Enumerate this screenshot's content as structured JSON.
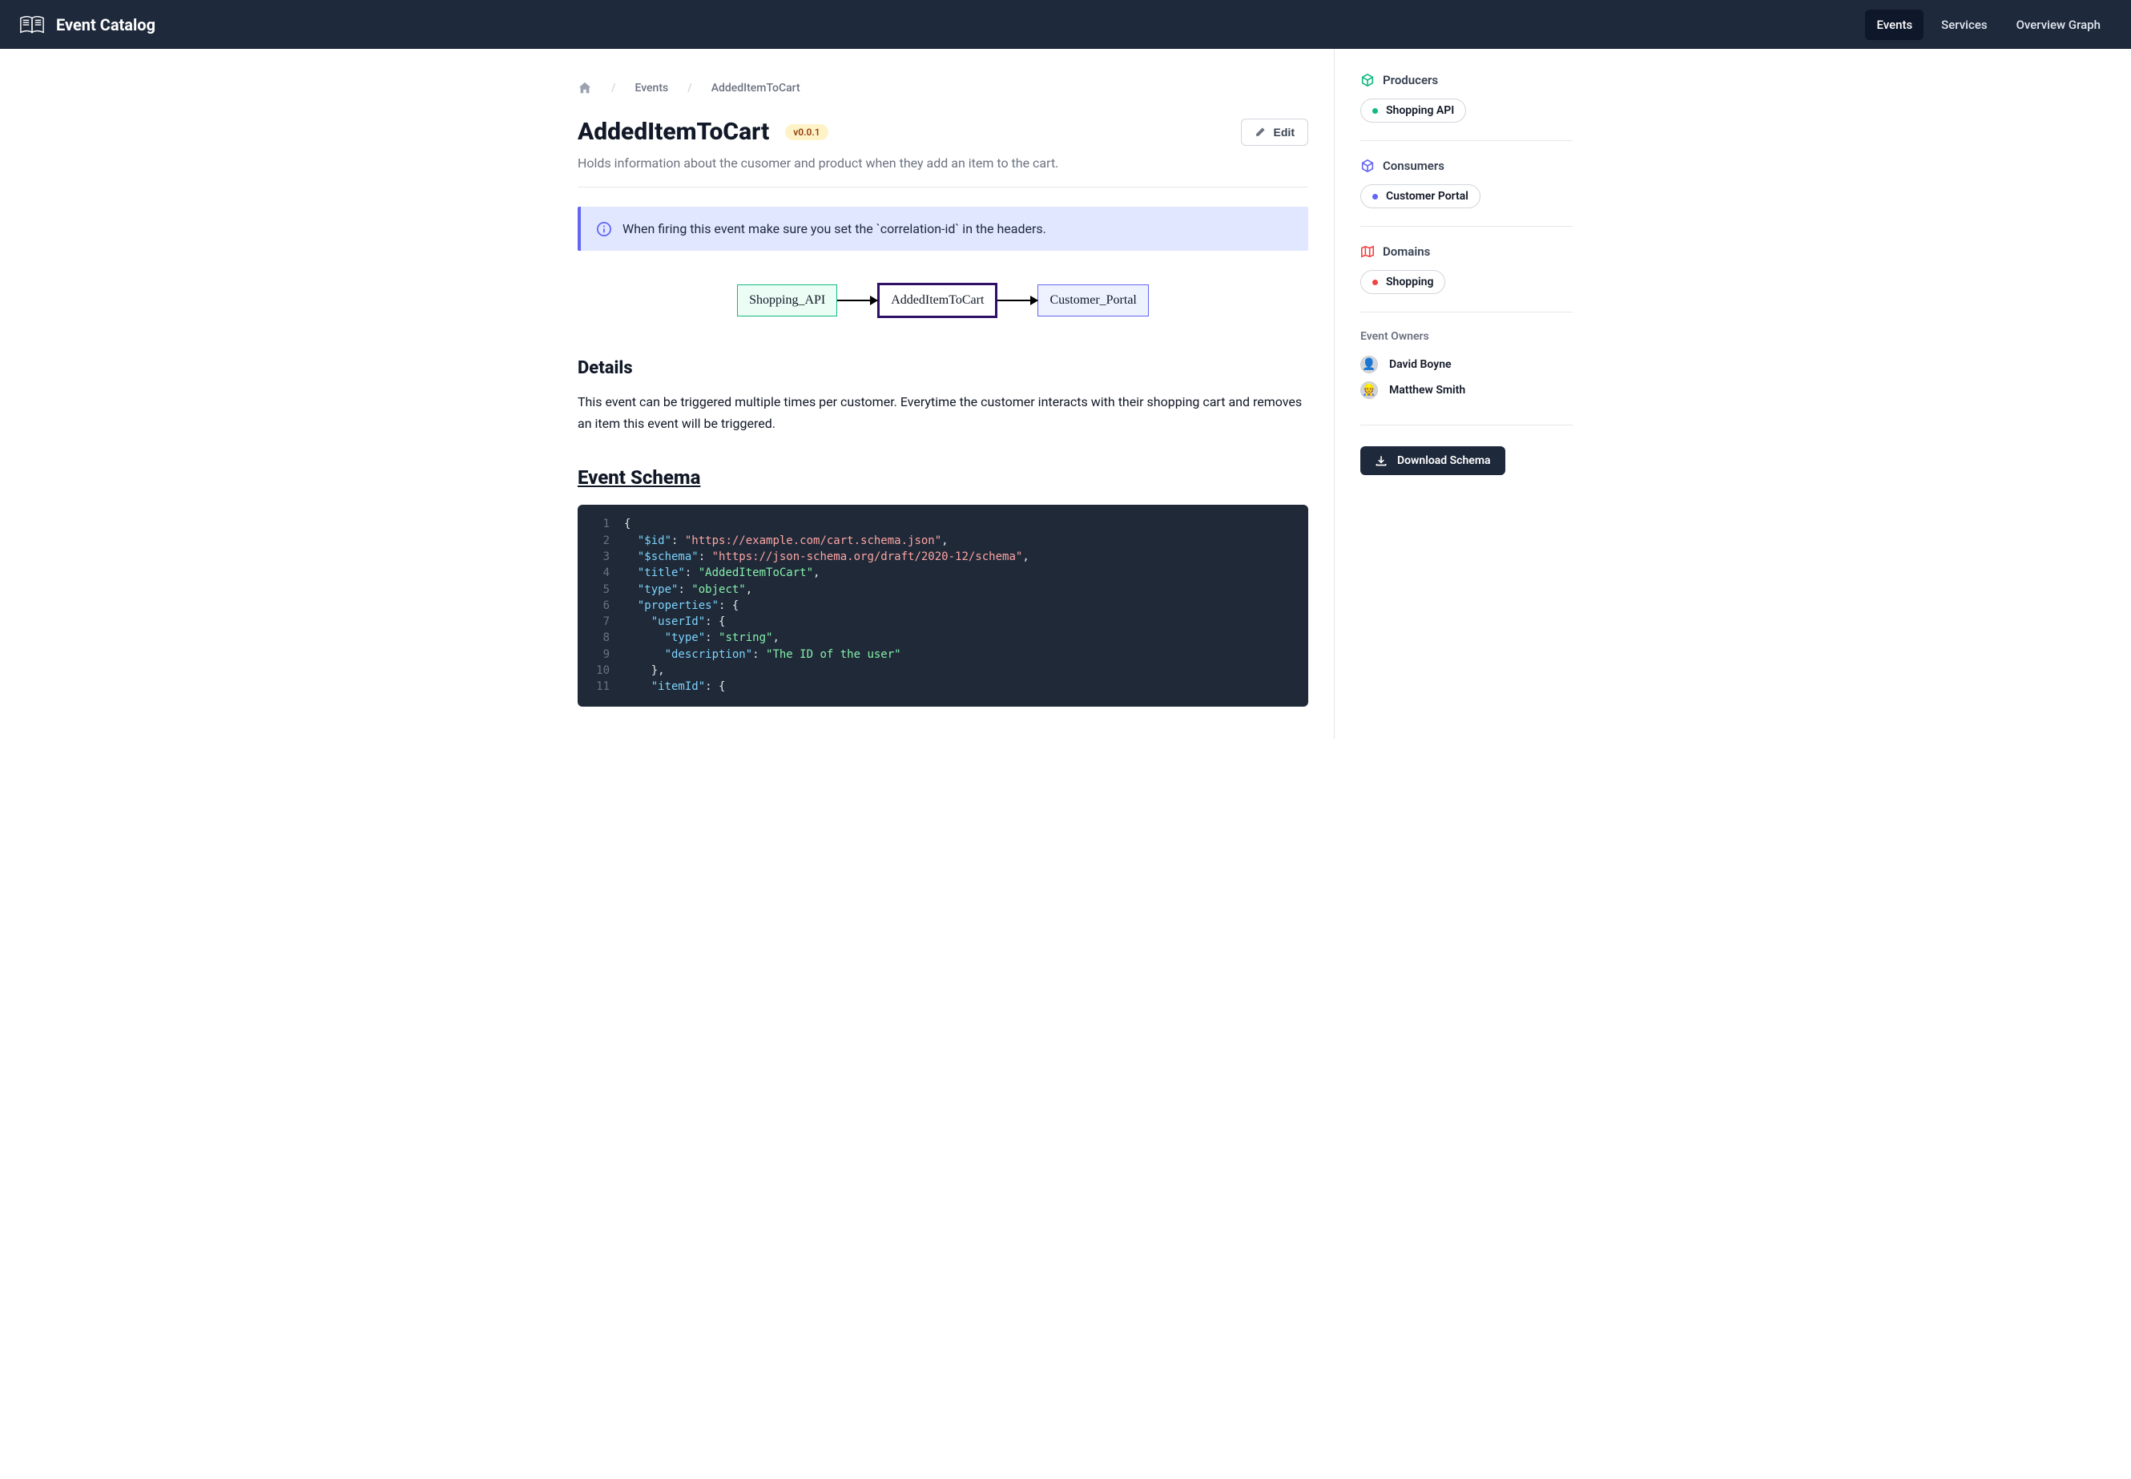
{
  "header": {
    "title": "Event Catalog",
    "nav": [
      {
        "label": "Events",
        "active": true
      },
      {
        "label": "Services",
        "active": false
      },
      {
        "label": "Overview Graph",
        "active": false
      }
    ]
  },
  "breadcrumb": {
    "root": "Events",
    "current": "AddedItemToCart"
  },
  "page": {
    "title": "AddedItemToCart",
    "version": "v0.0.1",
    "edit_label": "Edit",
    "description": "Holds information about the cusomer and product when they add an item to the cart.",
    "admonition": "When firing this event make sure you set the `correlation-id` in the headers."
  },
  "diagram": {
    "producer": "Shopping_API",
    "event": "AddedItemToCart",
    "consumer": "Customer_Portal"
  },
  "details": {
    "heading": "Details",
    "text": "This event can be triggered multiple times per customer. Everytime the customer interacts with their shopping cart and removes an item this event will be triggered."
  },
  "schema": {
    "heading": "Event Schema",
    "lines": [
      [
        {
          "t": "punct",
          "v": "{"
        }
      ],
      [
        {
          "t": "punct",
          "v": "  "
        },
        {
          "t": "key",
          "v": "\"$id\""
        },
        {
          "t": "punct",
          "v": ": "
        },
        {
          "t": "str",
          "v": "\"https://example.com/cart.schema.json\""
        },
        {
          "t": "punct",
          "v": ","
        }
      ],
      [
        {
          "t": "punct",
          "v": "  "
        },
        {
          "t": "key",
          "v": "\"$schema\""
        },
        {
          "t": "punct",
          "v": ": "
        },
        {
          "t": "str",
          "v": "\"https://json-schema.org/draft/2020-12/schema\""
        },
        {
          "t": "punct",
          "v": ","
        }
      ],
      [
        {
          "t": "punct",
          "v": "  "
        },
        {
          "t": "key",
          "v": "\"title\""
        },
        {
          "t": "punct",
          "v": ": "
        },
        {
          "t": "str2",
          "v": "\"AddedItemToCart\""
        },
        {
          "t": "punct",
          "v": ","
        }
      ],
      [
        {
          "t": "punct",
          "v": "  "
        },
        {
          "t": "key",
          "v": "\"type\""
        },
        {
          "t": "punct",
          "v": ": "
        },
        {
          "t": "str2",
          "v": "\"object\""
        },
        {
          "t": "punct",
          "v": ","
        }
      ],
      [
        {
          "t": "punct",
          "v": "  "
        },
        {
          "t": "key",
          "v": "\"properties\""
        },
        {
          "t": "punct",
          "v": ": {"
        }
      ],
      [
        {
          "t": "punct",
          "v": "    "
        },
        {
          "t": "key",
          "v": "\"userId\""
        },
        {
          "t": "punct",
          "v": ": {"
        }
      ],
      [
        {
          "t": "punct",
          "v": "      "
        },
        {
          "t": "key",
          "v": "\"type\""
        },
        {
          "t": "punct",
          "v": ": "
        },
        {
          "t": "str2",
          "v": "\"string\""
        },
        {
          "t": "punct",
          "v": ","
        }
      ],
      [
        {
          "t": "punct",
          "v": "      "
        },
        {
          "t": "key",
          "v": "\"description\""
        },
        {
          "t": "punct",
          "v": ": "
        },
        {
          "t": "str2",
          "v": "\"The ID of the user\""
        }
      ],
      [
        {
          "t": "punct",
          "v": "    },"
        }
      ],
      [
        {
          "t": "punct",
          "v": "    "
        },
        {
          "t": "key",
          "v": "\"itemId\""
        },
        {
          "t": "punct",
          "v": ": {"
        }
      ]
    ]
  },
  "sidebar": {
    "producers": {
      "title": "Producers",
      "items": [
        "Shopping API"
      ]
    },
    "consumers": {
      "title": "Consumers",
      "items": [
        "Customer Portal"
      ]
    },
    "domains": {
      "title": "Domains",
      "items": [
        "Shopping"
      ]
    },
    "owners": {
      "title": "Event Owners",
      "people": [
        {
          "name": "David Boyne",
          "emoji": "👤"
        },
        {
          "name": "Matthew Smith",
          "emoji": "👷"
        }
      ]
    },
    "download_label": "Download Schema"
  }
}
